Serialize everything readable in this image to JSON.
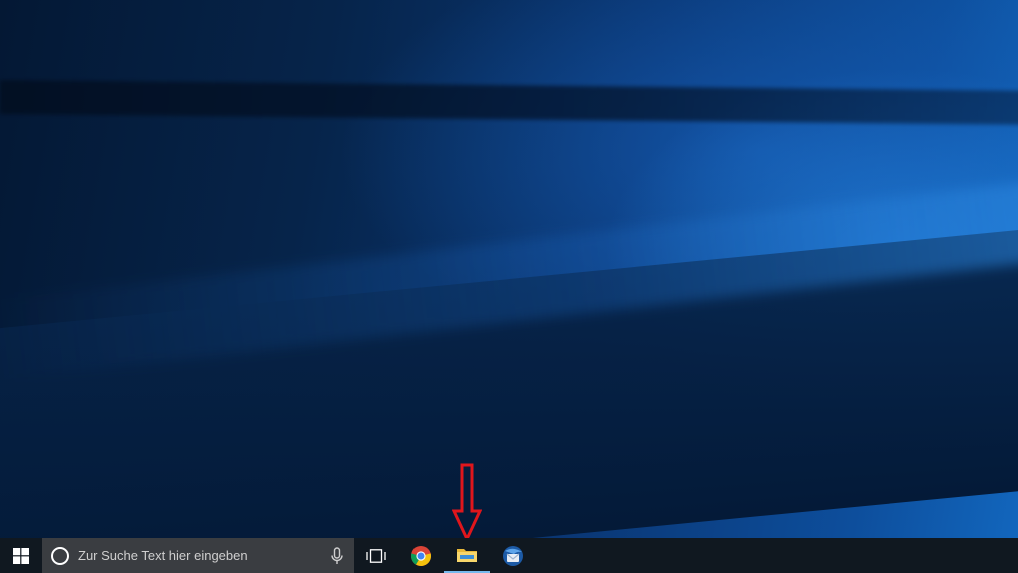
{
  "desktop": {
    "wallpaper": "Windows 10 Hero",
    "annotation_arrow_color": "#e0161c"
  },
  "taskbar": {
    "start_icon": "windows-logo-icon",
    "search": {
      "placeholder": "Zur Suche Text hier eingeben",
      "cortana_icon": "cortana-icon",
      "mic_icon": "microphone-icon"
    },
    "task_view_icon": "task-view-icon",
    "pinned_apps": [
      {
        "name": "Google Chrome",
        "icon": "chrome-icon"
      },
      {
        "name": "File Explorer",
        "icon": "file-explorer-icon"
      },
      {
        "name": "Thunderbird",
        "icon": "thunderbird-icon"
      }
    ],
    "accent_color": "#76b9ed"
  }
}
